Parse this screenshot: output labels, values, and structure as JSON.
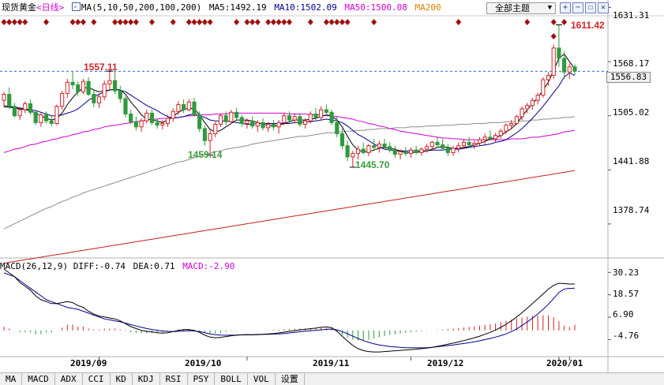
{
  "header": {
    "title": "现货黄金",
    "period": "<日线>",
    "ma_label": "MA(5,10,50,200,100,200)",
    "ma5": "MA5:1492.19",
    "ma10": "MA10:1502.09",
    "ma50": "MA50:1500.08",
    "ma200": "MA200",
    "theme_button": "全部主题",
    "theme_arrow": "▼"
  },
  "window_buttons": [
    "+",
    "−",
    "☐",
    "✕"
  ],
  "price_axis": {
    "ticks": [
      "1631.31",
      "1568.17",
      "1505.02",
      "1441.88",
      "1378.74"
    ],
    "current_price": "1556.83"
  },
  "annotations": {
    "high_jan": "1611.42",
    "high_sep": "1557.11",
    "low_oct": "1459.14",
    "low_nov": "1445.70"
  },
  "macd": {
    "label": "MACD(26,12,9)",
    "diff": "DIFF:-0.74",
    "dea": "DEA:0.71",
    "macd_val": "MACD:-2.90",
    "ticks": [
      "30.23",
      "18.57",
      "6.90",
      "-4.76"
    ]
  },
  "time_axis": [
    "2019/09",
    "2019/10",
    "2019/11",
    "2019/12",
    "2020/01"
  ],
  "tabs": [
    "MA",
    "MACD",
    "ADX",
    "CCI",
    "KD",
    "KDJ",
    "RSI",
    "PSY",
    "BOLL",
    "VOL",
    "设置"
  ],
  "colors": {
    "up": "#d2232a",
    "down": "#2f9a3c",
    "ma5": "#000000",
    "ma10": "#00008b",
    "ma50": "#d000d0",
    "ma100": "#8c8c8c",
    "ma200": "#c8201e",
    "ann_high": "#d2232a",
    "ann_low": "#3c9c3c",
    "marker": "#a01010"
  },
  "chart_data": {
    "type": "candlestick",
    "title": "现货黄金",
    "period": "daily",
    "yrange": [
      1340,
      1640
    ],
    "macd_range": [
      -12,
      32
    ],
    "ohlc": [
      [
        1523,
        1533,
        1515,
        1530
      ],
      [
        1530,
        1538,
        1513,
        1516
      ],
      [
        1516,
        1520,
        1503,
        1505
      ],
      [
        1505,
        1515,
        1500,
        1512
      ],
      [
        1512,
        1522,
        1508,
        1519
      ],
      [
        1519,
        1524,
        1506,
        1509
      ],
      [
        1509,
        1512,
        1494,
        1497
      ],
      [
        1497,
        1508,
        1492,
        1506
      ],
      [
        1506,
        1510,
        1496,
        1499
      ],
      [
        1499,
        1506,
        1493,
        1496
      ],
      [
        1496,
        1518,
        1494,
        1516
      ],
      [
        1516,
        1534,
        1512,
        1531
      ],
      [
        1531,
        1548,
        1526,
        1544
      ],
      [
        1544,
        1556,
        1536,
        1541
      ],
      [
        1541,
        1545,
        1528,
        1533
      ],
      [
        1533,
        1548,
        1530,
        1545
      ],
      [
        1545,
        1550,
        1528,
        1530
      ],
      [
        1530,
        1536,
        1515,
        1520
      ],
      [
        1520,
        1530,
        1514,
        1527
      ],
      [
        1527,
        1546,
        1523,
        1542
      ],
      [
        1542,
        1558,
        1535,
        1546
      ],
      [
        1546,
        1557,
        1530,
        1534
      ],
      [
        1534,
        1540,
        1520,
        1525
      ],
      [
        1525,
        1528,
        1503,
        1507
      ],
      [
        1507,
        1512,
        1495,
        1498
      ],
      [
        1498,
        1504,
        1488,
        1492
      ],
      [
        1492,
        1502,
        1486,
        1499
      ],
      [
        1499,
        1512,
        1496,
        1508
      ],
      [
        1508,
        1512,
        1494,
        1497
      ],
      [
        1497,
        1502,
        1490,
        1494
      ],
      [
        1494,
        1500,
        1489,
        1496
      ],
      [
        1496,
        1506,
        1492,
        1502
      ],
      [
        1502,
        1514,
        1498,
        1510
      ],
      [
        1510,
        1522,
        1506,
        1518
      ],
      [
        1518,
        1524,
        1508,
        1512
      ],
      [
        1512,
        1524,
        1510,
        1521
      ],
      [
        1521,
        1526,
        1504,
        1506
      ],
      [
        1506,
        1510,
        1486,
        1490
      ],
      [
        1490,
        1494,
        1470,
        1476
      ],
      [
        1476,
        1488,
        1459,
        1484
      ],
      [
        1484,
        1498,
        1480,
        1495
      ],
      [
        1495,
        1508,
        1492,
        1505
      ],
      [
        1505,
        1510,
        1494,
        1498
      ],
      [
        1498,
        1512,
        1496,
        1509
      ],
      [
        1509,
        1514,
        1500,
        1503
      ],
      [
        1503,
        1506,
        1492,
        1496
      ],
      [
        1496,
        1502,
        1490,
        1499
      ],
      [
        1499,
        1504,
        1490,
        1493
      ],
      [
        1493,
        1500,
        1486,
        1497
      ],
      [
        1497,
        1502,
        1488,
        1491
      ],
      [
        1491,
        1498,
        1486,
        1495
      ],
      [
        1495,
        1500,
        1488,
        1492
      ],
      [
        1492,
        1500,
        1484,
        1497
      ],
      [
        1497,
        1508,
        1494,
        1505
      ],
      [
        1505,
        1510,
        1496,
        1500
      ],
      [
        1500,
        1508,
        1496,
        1504
      ],
      [
        1504,
        1508,
        1492,
        1495
      ],
      [
        1495,
        1502,
        1490,
        1499
      ],
      [
        1499,
        1510,
        1496,
        1507
      ],
      [
        1507,
        1514,
        1500,
        1503
      ],
      [
        1503,
        1516,
        1500,
        1512
      ],
      [
        1512,
        1518,
        1505,
        1509
      ],
      [
        1509,
        1512,
        1494,
        1497
      ],
      [
        1497,
        1504,
        1480,
        1484
      ],
      [
        1484,
        1490,
        1466,
        1470
      ],
      [
        1470,
        1476,
        1452,
        1457
      ],
      [
        1457,
        1464,
        1445,
        1461
      ],
      [
        1461,
        1470,
        1454,
        1466
      ],
      [
        1466,
        1474,
        1460,
        1462
      ],
      [
        1462,
        1472,
        1458,
        1470
      ],
      [
        1470,
        1478,
        1464,
        1468
      ],
      [
        1468,
        1476,
        1462,
        1472
      ],
      [
        1472,
        1478,
        1466,
        1469
      ],
      [
        1469,
        1474,
        1462,
        1465
      ],
      [
        1465,
        1470,
        1456,
        1460
      ],
      [
        1460,
        1466,
        1454,
        1463
      ],
      [
        1463,
        1468,
        1458,
        1461
      ],
      [
        1461,
        1468,
        1456,
        1465
      ],
      [
        1465,
        1470,
        1460,
        1462
      ],
      [
        1462,
        1468,
        1458,
        1466
      ],
      [
        1466,
        1472,
        1462,
        1469
      ],
      [
        1469,
        1476,
        1464,
        1474
      ],
      [
        1474,
        1480,
        1468,
        1471
      ],
      [
        1471,
        1478,
        1464,
        1467
      ],
      [
        1467,
        1472,
        1458,
        1462
      ],
      [
        1462,
        1470,
        1458,
        1467
      ],
      [
        1467,
        1474,
        1462,
        1470
      ],
      [
        1470,
        1478,
        1466,
        1474
      ],
      [
        1474,
        1480,
        1468,
        1471
      ],
      [
        1471,
        1476,
        1466,
        1473
      ],
      [
        1473,
        1480,
        1470,
        1477
      ],
      [
        1477,
        1484,
        1472,
        1480
      ],
      [
        1480,
        1488,
        1476,
        1478
      ],
      [
        1478,
        1485,
        1474,
        1482
      ],
      [
        1482,
        1490,
        1478,
        1487
      ],
      [
        1487,
        1496,
        1484,
        1494
      ],
      [
        1494,
        1500,
        1489,
        1496
      ],
      [
        1496,
        1506,
        1494,
        1504
      ],
      [
        1504,
        1516,
        1500,
        1513
      ],
      [
        1513,
        1520,
        1508,
        1517
      ],
      [
        1517,
        1526,
        1512,
        1523
      ],
      [
        1523,
        1532,
        1518,
        1529
      ],
      [
        1529,
        1550,
        1526,
        1547
      ],
      [
        1547,
        1556,
        1540,
        1552
      ],
      [
        1552,
        1588,
        1548,
        1584
      ],
      [
        1584,
        1611,
        1562,
        1572
      ],
      [
        1572,
        1580,
        1548,
        1556
      ],
      [
        1556,
        1566,
        1548,
        1562
      ],
      [
        1562,
        1565,
        1552,
        1557
      ]
    ],
    "ma5": [
      1515,
      1515,
      1514,
      1513,
      1512,
      1511,
      1508,
      1505,
      1502,
      1500,
      1502,
      1508,
      1518,
      1526,
      1533,
      1537,
      1538,
      1535,
      1533,
      1534,
      1535,
      1536,
      1535,
      1530,
      1521,
      1514,
      1506,
      1501,
      1500,
      1499,
      1497,
      1500,
      1504,
      1509,
      1512,
      1514,
      1513,
      1506,
      1497,
      1489,
      1486,
      1488,
      1492,
      1496,
      1500,
      1500,
      1500,
      1499,
      1497,
      1495,
      1494,
      1493,
      1494,
      1496,
      1498,
      1500,
      1500,
      1500,
      1501,
      1502,
      1504,
      1506,
      1505,
      1500,
      1492,
      1481,
      1471,
      1465,
      1463,
      1463,
      1465,
      1467,
      1468,
      1467,
      1466,
      1464,
      1462,
      1462,
      1462,
      1463,
      1464,
      1466,
      1468,
      1469,
      1468,
      1467,
      1467,
      1468,
      1469,
      1471,
      1473,
      1475,
      1478,
      1479,
      1482,
      1486,
      1490,
      1496,
      1504,
      1512,
      1519,
      1526,
      1535,
      1544,
      1558,
      1572,
      1577,
      1568,
      1560
    ],
    "ma10": [
      1517,
      1516,
      1515,
      1514,
      1513,
      1512,
      1511,
      1509,
      1507,
      1505,
      1505,
      1506,
      1508,
      1510,
      1513,
      1518,
      1523,
      1527,
      1530,
      1533,
      1535,
      1536,
      1535,
      1533,
      1529,
      1525,
      1521,
      1517,
      1514,
      1511,
      1507,
      1504,
      1502,
      1503,
      1504,
      1506,
      1507,
      1505,
      1503,
      1500,
      1499,
      1499,
      1499,
      1498,
      1497,
      1496,
      1495,
      1495,
      1496,
      1496,
      1496,
      1496,
      1496,
      1496,
      1496,
      1497,
      1497,
      1498,
      1498,
      1499,
      1500,
      1501,
      1500,
      1499,
      1497,
      1493,
      1488,
      1483,
      1480,
      1476,
      1472,
      1469,
      1466,
      1465,
      1464,
      1464,
      1464,
      1464,
      1464,
      1464,
      1464,
      1465,
      1465,
      1465,
      1466,
      1466,
      1466,
      1467,
      1468,
      1469,
      1470,
      1471,
      1472,
      1474,
      1475,
      1477,
      1481,
      1485,
      1490,
      1496,
      1502,
      1509,
      1516,
      1524,
      1532,
      1540,
      1550,
      1555,
      1552
    ],
    "ma50": [
      1462,
      1464,
      1466,
      1467,
      1469,
      1471,
      1472,
      1474,
      1475,
      1477,
      1478,
      1480,
      1481,
      1483,
      1484,
      1486,
      1487,
      1489,
      1490,
      1492,
      1493,
      1494,
      1495,
      1496,
      1497,
      1498,
      1499,
      1500,
      1501,
      1501,
      1502,
      1502,
      1503,
      1503,
      1504,
      1505,
      1505,
      1506,
      1506,
      1506,
      1507,
      1507,
      1507,
      1508,
      1508,
      1508,
      1508,
      1508,
      1508,
      1508,
      1508,
      1508,
      1508,
      1508,
      1507,
      1507,
      1507,
      1507,
      1506,
      1506,
      1506,
      1505,
      1505,
      1504,
      1503,
      1502,
      1501,
      1499,
      1498,
      1496,
      1495,
      1493,
      1492,
      1490,
      1489,
      1487,
      1486,
      1485,
      1484,
      1483,
      1482,
      1481,
      1480,
      1479,
      1479,
      1478,
      1478,
      1477,
      1477,
      1477,
      1477,
      1477,
      1477,
      1477,
      1477,
      1477,
      1478,
      1478,
      1478,
      1479,
      1480,
      1480,
      1481,
      1482,
      1483,
      1484,
      1486,
      1487,
      1488
    ],
    "ma100": [
      1373,
      1376,
      1379,
      1382,
      1385,
      1388,
      1391,
      1394,
      1397,
      1399,
      1402,
      1405,
      1407,
      1410,
      1412,
      1415,
      1417,
      1419,
      1421,
      1423,
      1425,
      1427,
      1429,
      1431,
      1433,
      1435,
      1437,
      1439,
      1441,
      1443,
      1445,
      1447,
      1449,
      1451,
      1452,
      1454,
      1456,
      1458,
      1460,
      1461,
      1463,
      1464,
      1466,
      1467,
      1468,
      1469,
      1470,
      1472,
      1473,
      1474,
      1475,
      1476,
      1477,
      1478,
      1479,
      1480,
      1481,
      1481,
      1482,
      1483,
      1484,
      1485,
      1485,
      1486,
      1486,
      1487,
      1487,
      1488,
      1488,
      1489,
      1489,
      1490,
      1490,
      1490,
      1491,
      1491,
      1491,
      1492,
      1492,
      1492,
      1493,
      1493,
      1493,
      1494,
      1494,
      1494,
      1495,
      1495,
      1495,
      1496,
      1496,
      1496,
      1497,
      1497,
      1497,
      1498,
      1498,
      1498,
      1499,
      1499,
      1500,
      1500,
      1501,
      1501,
      1502,
      1502,
      1503,
      1503,
      1504
    ],
    "ma200": [
      1333,
      1334,
      1335,
      1336,
      1337,
      1338,
      1339,
      1340,
      1341,
      1342,
      1343,
      1344,
      1345,
      1346,
      1347,
      1348,
      1349,
      1350,
      1351,
      1352,
      1353,
      1354,
      1355,
      1356,
      1357,
      1358,
      1359,
      1360,
      1361,
      1362,
      1363,
      1364,
      1365,
      1366,
      1367,
      1368,
      1369,
      1370,
      1371,
      1372,
      1373,
      1374,
      1375,
      1376,
      1377,
      1378,
      1379,
      1380,
      1381,
      1382,
      1383,
      1384,
      1385,
      1386,
      1387,
      1388,
      1389,
      1390,
      1391,
      1392,
      1393,
      1394,
      1395,
      1396,
      1397,
      1398,
      1399,
      1400,
      1401,
      1402,
      1403,
      1404,
      1405,
      1406,
      1407,
      1408,
      1409,
      1410,
      1411,
      1412,
      1413,
      1414,
      1415,
      1416,
      1417,
      1418,
      1419,
      1420,
      1421,
      1422,
      1423,
      1424,
      1425,
      1426,
      1427,
      1428,
      1429,
      1430,
      1431,
      1432,
      1433,
      1434,
      1435,
      1436,
      1437,
      1438,
      1439,
      1440,
      1441
    ],
    "dea": [
      30,
      29,
      28,
      26,
      24,
      22,
      20,
      18,
      16,
      15,
      14,
      13,
      12,
      11.5,
      11,
      10,
      9,
      8,
      7,
      6,
      5.5,
      5,
      4.5,
      3.8,
      3,
      2.3,
      1.6,
      1,
      0.5,
      0,
      -0.3,
      -0.5,
      -0.6,
      -0.5,
      -0.3,
      -0.2,
      -0.3,
      -0.6,
      -1.2,
      -1.8,
      -2.2,
      -2.4,
      -2.5,
      -2.5,
      -2.4,
      -2.3,
      -2.2,
      -2.2,
      -2.1,
      -2.0,
      -2.0,
      -1.9,
      -1.8,
      -1.6,
      -1.3,
      -1.0,
      -0.7,
      -0.4,
      -0.2,
      0,
      0.3,
      0.6,
      0.7,
      0.3,
      -0.6,
      -1.7,
      -3,
      -4.2,
      -5.3,
      -6.2,
      -7,
      -7.6,
      -8,
      -8.4,
      -8.6,
      -8.8,
      -9,
      -9,
      -9.1,
      -9.1,
      -9,
      -8.8,
      -8.5,
      -8.2,
      -7.9,
      -7.6,
      -7.2,
      -6.8,
      -6.4,
      -5.9,
      -5.4,
      -4.8,
      -4.2,
      -3.5,
      -2.7,
      -1.8,
      -0.6,
      0.8,
      2.5,
      4.4,
      6.4,
      8.6,
      11,
      13.6,
      16.6,
      19.8,
      21.6,
      21.9,
      22
    ],
    "diff": [
      32,
      30,
      28,
      25,
      23,
      21,
      18,
      16,
      15,
      14,
      14,
      14.5,
      15,
      14.5,
      13,
      12,
      10,
      8.5,
      7.5,
      7,
      6.5,
      6,
      5,
      3.5,
      2,
      1,
      0,
      -0.5,
      -0.8,
      -1.2,
      -1.4,
      -1.2,
      -0.6,
      0,
      0.4,
      0.5,
      0,
      -1,
      -2.5,
      -3.5,
      -3.8,
      -3.6,
      -3.2,
      -2.8,
      -2.5,
      -2.3,
      -2.2,
      -2.3,
      -2.2,
      -2.0,
      -1.8,
      -1.6,
      -1.3,
      -0.9,
      -0.5,
      -0.1,
      0.3,
      0.6,
      0.9,
      1.2,
      1.6,
      1.8,
      1.4,
      -0.4,
      -3,
      -5.5,
      -7.8,
      -9.5,
      -10.5,
      -11,
      -11.2,
      -11.2,
      -11,
      -10.8,
      -10.6,
      -10.4,
      -10.2,
      -10,
      -9.8,
      -9.5,
      -9.2,
      -8.8,
      -8.3,
      -7.8,
      -7.2,
      -6.6,
      -6,
      -5.3,
      -4.6,
      -3.8,
      -3,
      -2,
      -1,
      0.2,
      1.6,
      3.2,
      5,
      7,
      9.2,
      11.6,
      14,
      16.5,
      19,
      21.5,
      23.5,
      24.6,
      24.4,
      24.2,
      24.2
    ],
    "macd_hist": [
      -2,
      -1,
      0,
      1,
      1,
      1,
      2,
      2,
      1,
      1,
      0,
      -1.5,
      -3,
      -3,
      -2,
      -2,
      -1,
      -0.5,
      -0.5,
      -1,
      -1,
      -1,
      -0.5,
      0.3,
      1,
      1.3,
      1.6,
      1.5,
      1.3,
      1.2,
      1.1,
      0.7,
      0,
      -0.5,
      -0.7,
      -0.7,
      -0.3,
      0.4,
      1.3,
      1.7,
      1.6,
      1.2,
      0.7,
      0.3,
      0.1,
      0,
      0,
      0.1,
      0.1,
      0,
      -0.2,
      -0.3,
      -0.5,
      -0.7,
      -0.8,
      -0.9,
      -1,
      -1,
      -1.1,
      -1.2,
      -1.3,
      -1.2,
      -0.7,
      0.7,
      2.4,
      3.8,
      4.8,
      5.3,
      5.2,
      4.8,
      4.2,
      3.6,
      3,
      2.4,
      2,
      1.6,
      1.2,
      1,
      0.7,
      0.4,
      0.2,
      0,
      -0.2,
      -0.4,
      -0.7,
      -1,
      -1.2,
      -1.5,
      -1.8,
      -2.1,
      -2.4,
      -2.8,
      -3.2,
      -3.7,
      -4.3,
      -5,
      -5.6,
      -6.2,
      -6.7,
      -7.2,
      -7.6,
      -7.9,
      -8,
      -7.9,
      -6.8,
      -4.8,
      -2.5,
      -1.8,
      -2.9
    ]
  }
}
